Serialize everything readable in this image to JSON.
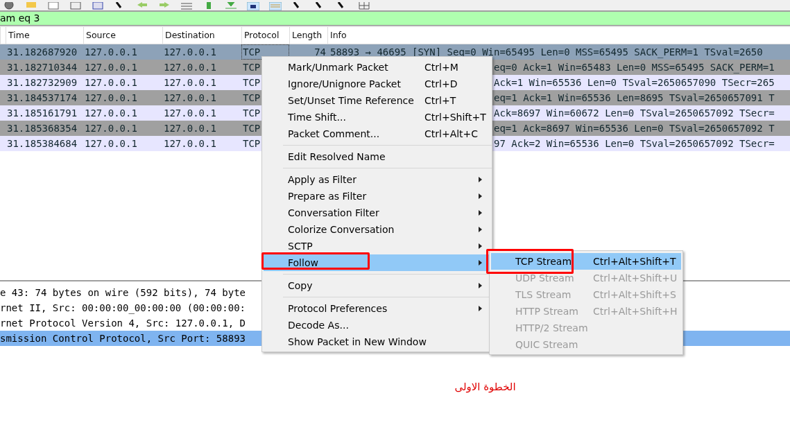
{
  "filter": {
    "value": "am eq 3"
  },
  "table": {
    "columns": [
      "Time",
      "Source",
      "Destination",
      "Protocol",
      "Length",
      "Info"
    ],
    "rows": [
      {
        "time": "31.182687920",
        "source": "127.0.0.1",
        "destination": "127.0.0.1",
        "protocol": "TCP",
        "length": "74",
        "info": "58893 → 46695 [SYN] Seq=0 Win=65495 Len=0 MSS=65495 SACK_PERM=1 TSval=2650",
        "covered": false,
        "selected": true,
        "color": "#8da2b8"
      },
      {
        "time": "31.182710344",
        "source": "127.0.0.1",
        "destination": "127.0.0.1",
        "protocol": "TCP",
        "info": "eq=0 Ack=1 Win=65483 Len=0 MSS=65495 SACK_PERM=1",
        "covered": true,
        "selected": false,
        "color": "#a0a0a0"
      },
      {
        "time": "31.182732909",
        "source": "127.0.0.1",
        "destination": "127.0.0.1",
        "protocol": "TCP",
        "info": "Ack=1 Win=65536 Len=0 TSval=2650657090 TSecr=265",
        "covered": true,
        "selected": false,
        "color": "#e7e6ff"
      },
      {
        "time": "31.184537174",
        "source": "127.0.0.1",
        "destination": "127.0.0.1",
        "protocol": "TCP",
        "info": "eq=1 Ack=1 Win=65536 Len=8695 TSval=2650657091 T",
        "covered": true,
        "selected": false,
        "color": "#a0a0a0"
      },
      {
        "time": "31.185161791",
        "source": "127.0.0.1",
        "destination": "127.0.0.1",
        "protocol": "TCP",
        "info": "Ack=8697 Win=60672 Len=0 TSval=2650657092 TSecr=",
        "covered": true,
        "selected": false,
        "color": "#e7e6ff"
      },
      {
        "time": "31.185368354",
        "source": "127.0.0.1",
        "destination": "127.0.0.1",
        "protocol": "TCP",
        "info": "eq=1 Ack=8697 Win=65536 Len=0 TSval=2650657092 T",
        "covered": true,
        "selected": false,
        "color": "#a0a0a0"
      },
      {
        "time": "31.185384684",
        "source": "127.0.0.1",
        "destination": "127.0.0.1",
        "protocol": "TCP",
        "info": "97 Ack=2 Win=65536 Len=0 TSval=2650657092 TSecr=",
        "covered": true,
        "selected": false,
        "color": "#e7e6ff"
      }
    ]
  },
  "details": [
    {
      "text": "e 43: 74 bytes on wire (592 bits), 74 byte",
      "selected": false
    },
    {
      "text": "rnet II, Src: 00:00:00_00:00:00 (00:00:00:",
      "selected": false
    },
    {
      "text": "rnet Protocol Version 4, Src: 127.0.0.1, D",
      "selected": false
    },
    {
      "text": "smission Control Protocol, Src Port: 58893",
      "selected": true
    }
  ],
  "context_menu": {
    "items": [
      {
        "kind": "item",
        "label": "Mark/Unmark Packet",
        "shortcut": "Ctrl+M",
        "submenu": false,
        "selected": false,
        "highlighted": false
      },
      {
        "kind": "item",
        "label": "Ignore/Unignore Packet",
        "shortcut": "Ctrl+D",
        "submenu": false,
        "selected": false,
        "highlighted": false
      },
      {
        "kind": "item",
        "label": "Set/Unset Time Reference",
        "shortcut": "Ctrl+T",
        "submenu": false,
        "selected": false,
        "highlighted": false
      },
      {
        "kind": "item",
        "label": "Time Shift...",
        "shortcut": "Ctrl+Shift+T",
        "submenu": false,
        "selected": false,
        "highlighted": false
      },
      {
        "kind": "item",
        "label": "Packet Comment...",
        "shortcut": "Ctrl+Alt+C",
        "submenu": false,
        "selected": false,
        "highlighted": false
      },
      {
        "kind": "separator"
      },
      {
        "kind": "item",
        "label": "Edit Resolved Name",
        "submenu": false,
        "selected": false,
        "highlighted": false
      },
      {
        "kind": "separator"
      },
      {
        "kind": "item",
        "label": "Apply as Filter",
        "submenu": true,
        "selected": false,
        "highlighted": false
      },
      {
        "kind": "item",
        "label": "Prepare as Filter",
        "submenu": true,
        "selected": false,
        "highlighted": false
      },
      {
        "kind": "item",
        "label": "Conversation Filter",
        "submenu": true,
        "selected": false,
        "highlighted": false
      },
      {
        "kind": "item",
        "label": "Colorize Conversation",
        "submenu": true,
        "selected": false,
        "highlighted": false
      },
      {
        "kind": "item",
        "label": "SCTP",
        "submenu": true,
        "selected": false,
        "highlighted": false
      },
      {
        "kind": "item",
        "label": "Follow",
        "submenu": true,
        "selected": true,
        "highlighted": true
      },
      {
        "kind": "separator"
      },
      {
        "kind": "item",
        "label": "Copy",
        "submenu": true,
        "selected": false,
        "highlighted": false
      },
      {
        "kind": "separator"
      },
      {
        "kind": "item",
        "label": "Protocol Preferences",
        "submenu": true,
        "selected": false,
        "highlighted": false
      },
      {
        "kind": "item",
        "label": "Decode As...",
        "submenu": false,
        "selected": false,
        "highlighted": false
      },
      {
        "kind": "item",
        "label": "Show Packet in New Window",
        "submenu": false,
        "selected": false,
        "highlighted": false
      }
    ]
  },
  "submenu": {
    "items": [
      {
        "label": "TCP Stream",
        "shortcut": "Ctrl+Alt+Shift+T",
        "disabled": false,
        "selected": true,
        "highlighted": true
      },
      {
        "label": "UDP Stream",
        "shortcut": "Ctrl+Alt+Shift+U",
        "disabled": true,
        "selected": false,
        "highlighted": false
      },
      {
        "label": "TLS Stream",
        "shortcut": "Ctrl+Alt+Shift+S",
        "disabled": true,
        "selected": false,
        "highlighted": false
      },
      {
        "label": "HTTP Stream",
        "shortcut": "Ctrl+Alt+Shift+H",
        "disabled": true,
        "selected": false,
        "highlighted": false
      },
      {
        "label": "HTTP/2 Stream",
        "disabled": true,
        "selected": false,
        "highlighted": false
      },
      {
        "label": "QUIC Stream",
        "disabled": true,
        "selected": false,
        "highlighted": false
      }
    ]
  },
  "caption": "الخطوة الاولى"
}
